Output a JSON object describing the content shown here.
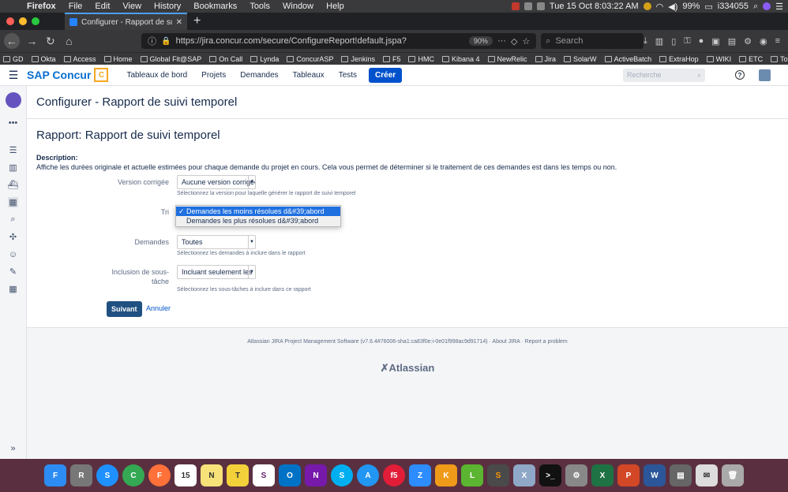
{
  "menubar": {
    "app": "Firefox",
    "items": [
      "File",
      "Edit",
      "View",
      "History",
      "Bookmarks",
      "Tools",
      "Window",
      "Help"
    ],
    "datetime": "Tue 15 Oct  8:03:22 AM",
    "battery": "99%",
    "user": "i334055"
  },
  "browser": {
    "tab_title": "Configurer - Rapport de suivi te",
    "url": "https://jira.concur.com/secure/ConfigureReport!default.jspa?",
    "zoom": "90%",
    "search_placeholder": "Search"
  },
  "bookmarks": [
    "GD",
    "Okta",
    "Access",
    "Home",
    "Global Fit@SAP",
    "On Call",
    "Lynda",
    "ConcurASP",
    "Jenkins",
    "F5",
    "HMC",
    "Kibana 4",
    "NewRelic",
    "Jira",
    "SolarW",
    "ActiveBatch",
    "ExtraHop",
    "WIKI",
    "ETC",
    "Tools"
  ],
  "header": {
    "brand": "SAP Concur",
    "nav": [
      "Tableaux de bord",
      "Projets",
      "Demandes",
      "Tableaux",
      "Tests"
    ],
    "create": "Créer",
    "search_placeholder": "Recherche",
    "help": "?"
  },
  "page": {
    "title": "Configurer - Rapport de suivi temporel",
    "report_title": "Rapport: Rapport de suivi temporel",
    "desc_label": "Description:",
    "desc": "Affiche les durées originale et actuelle estimées pour chaque demande du projet en cours. Cela vous permet de déterminer si le traitement de ces demandes est dans les temps ou non."
  },
  "form": {
    "version": {
      "label": "Version corrigée",
      "value": "Aucune version corrigée",
      "hint": "Sélectionnez la version pour laquelle générer le rapport de suivi temporel"
    },
    "tri": {
      "label": "Tri",
      "options": [
        "Demandes les moins résolues d&#39;abord",
        "Demandes les plus résolues d&#39;abord"
      ],
      "check": "✓"
    },
    "demandes": {
      "label": "Demandes",
      "value": "Toutes",
      "hint": "Sélectionnez les demandes à inclure dans le rapport"
    },
    "inclusion": {
      "label1": "Inclusion de sous-",
      "label2": "tâche",
      "value": "Incluant seulement les",
      "hint": "Sélectionnez les sous-tâches à inclure dans ce rapport"
    },
    "next": "Suivant",
    "cancel": "Annuler"
  },
  "footer": {
    "line": "Atlassian JIRA Project Management Software (v7.6.4#76006-sha1:ca83f0e:i-0e01f998ac9d91714)  ·  About JIRA  ·  Report a problem",
    "logo": "Atlassian"
  },
  "dock": [
    "F",
    "R",
    "S",
    "C",
    "F",
    "15",
    "N",
    "T",
    "S",
    "O",
    "N",
    "S",
    "A",
    "f5",
    "Z",
    "K",
    "L",
    "S",
    "X",
    ">_",
    "⚙",
    "X",
    "P",
    "W",
    "▤",
    "✉",
    "🗑"
  ]
}
